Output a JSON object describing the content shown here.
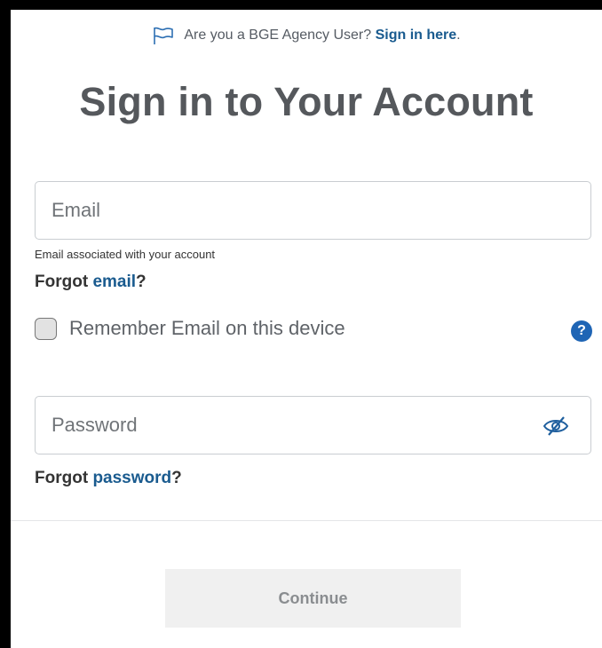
{
  "agency": {
    "prompt": "Are you a BGE Agency User?",
    "link_label": "Sign in here",
    "trailing": "."
  },
  "page": {
    "title": "Sign in to Your Account"
  },
  "email": {
    "placeholder": "Email",
    "value": "",
    "helper": "Email associated with your account",
    "forgot_prefix": "Forgot",
    "forgot_link": "email",
    "forgot_suffix": "?"
  },
  "remember": {
    "label": "Remember Email on this device",
    "checked": false,
    "help_glyph": "?"
  },
  "password": {
    "placeholder": "Password",
    "value": "",
    "forgot_prefix": "Forgot",
    "forgot_link": "password",
    "forgot_suffix": "?"
  },
  "actions": {
    "continue_label": "Continue"
  },
  "icons": {
    "agency": "flag-icon",
    "help": "question-circle-icon",
    "password_toggle": "eye-slash-icon"
  },
  "colors": {
    "link": "#1a5b8f",
    "help_icon": "#1f65b5",
    "button_disabled_bg": "#f0f0f0",
    "button_disabled_text": "#8a8d90"
  }
}
